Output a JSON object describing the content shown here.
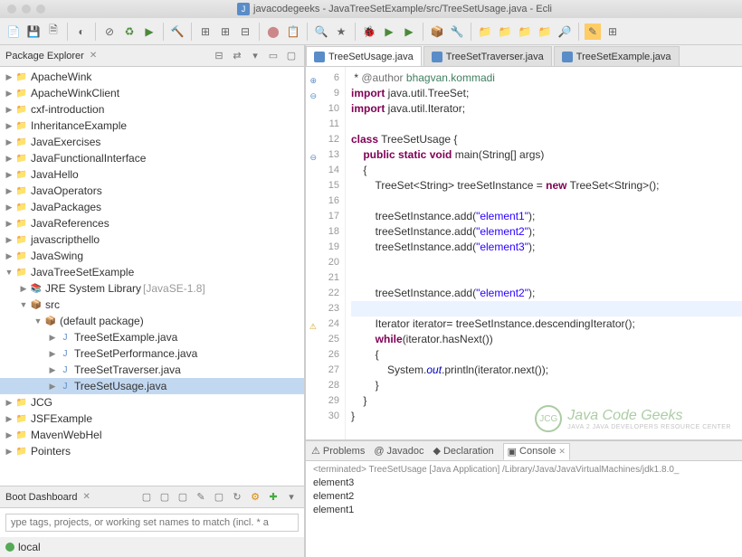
{
  "titlebar": {
    "title": "javacodegeeks - JavaTreeSetExample/src/TreeSetUsage.java - Ecli"
  },
  "packageExplorer": {
    "label": "Package Explorer",
    "items": [
      {
        "name": "ApacheWink",
        "icon": "folder",
        "indent": 0,
        "tw": "▶"
      },
      {
        "name": "ApacheWinkClient",
        "icon": "folder",
        "indent": 0,
        "tw": "▶"
      },
      {
        "name": "cxf-introduction",
        "icon": "folder",
        "indent": 0,
        "tw": "▶"
      },
      {
        "name": "InheritanceExample",
        "icon": "folder",
        "indent": 0,
        "tw": "▶"
      },
      {
        "name": "JavaExercises",
        "icon": "folder",
        "indent": 0,
        "tw": "▶"
      },
      {
        "name": "JavaFunctionalInterface",
        "icon": "folder",
        "indent": 0,
        "tw": "▶"
      },
      {
        "name": "JavaHello",
        "icon": "folder",
        "indent": 0,
        "tw": "▶"
      },
      {
        "name": "JavaOperators",
        "icon": "folder",
        "indent": 0,
        "tw": "▶"
      },
      {
        "name": "JavaPackages",
        "icon": "folder",
        "indent": 0,
        "tw": "▶"
      },
      {
        "name": "JavaReferences",
        "icon": "folder",
        "indent": 0,
        "tw": "▶"
      },
      {
        "name": "javascripthello",
        "icon": "folder",
        "indent": 0,
        "tw": "▶"
      },
      {
        "name": "JavaSwing",
        "icon": "folder",
        "indent": 0,
        "tw": "▶"
      },
      {
        "name": "JavaTreeSetExample",
        "icon": "folder",
        "indent": 0,
        "tw": "▼"
      },
      {
        "name": "JRE System Library",
        "lib": "[JavaSE-1.8]",
        "icon": "lib",
        "indent": 1,
        "tw": "▶"
      },
      {
        "name": "src",
        "icon": "pkg",
        "indent": 1,
        "tw": "▼"
      },
      {
        "name": "(default package)",
        "icon": "pkg",
        "indent": 2,
        "tw": "▼"
      },
      {
        "name": "TreeSetExample.java",
        "icon": "java",
        "indent": 3,
        "tw": "▶"
      },
      {
        "name": "TreeSetPerformance.java",
        "icon": "java",
        "indent": 3,
        "tw": "▶"
      },
      {
        "name": "TreeSetTraverser.java",
        "icon": "java",
        "indent": 3,
        "tw": "▶"
      },
      {
        "name": "TreeSetUsage.java",
        "icon": "java",
        "indent": 3,
        "tw": "▶",
        "selected": true
      },
      {
        "name": "JCG",
        "icon": "folder",
        "indent": 0,
        "tw": "▶"
      },
      {
        "name": "JSFExample",
        "icon": "folder",
        "indent": 0,
        "tw": "▶"
      },
      {
        "name": "MavenWebHel",
        "icon": "folder",
        "indent": 0,
        "tw": "▶"
      },
      {
        "name": "Pointers",
        "icon": "folder",
        "indent": 0,
        "tw": "▶"
      }
    ]
  },
  "bootDashboard": {
    "label": "Boot Dashboard",
    "placeholder": "ype tags, projects, or working set names to match (incl. * a",
    "local": "local"
  },
  "editorTabs": [
    {
      "label": "TreeSetUsage.java",
      "active": true
    },
    {
      "label": "TreeSetTraverser.java",
      "active": false
    },
    {
      "label": "TreeSetExample.java",
      "active": false
    }
  ],
  "code": {
    "startLine": 6,
    "lines": [
      {
        "n": 6,
        "mark": "+",
        "html": " * <span class='ann'>@author</span> <span class='com'>bhagvan.kommadi</span>"
      },
      {
        "n": 9,
        "mark": "-",
        "html": "<span class='kw'>import</span> java.util.TreeSet;"
      },
      {
        "n": 10,
        "html": "<span class='kw'>import</span> java.util.Iterator;"
      },
      {
        "n": 11,
        "html": ""
      },
      {
        "n": 12,
        "html": "<span class='kw'>class</span> TreeSetUsage {"
      },
      {
        "n": 13,
        "mark": "-",
        "html": "    <span class='kw'>public static void</span> main(String[] args)"
      },
      {
        "n": 14,
        "html": "    {"
      },
      {
        "n": 15,
        "html": "        TreeSet&lt;String&gt; treeSetInstance = <span class='kw'>new</span> TreeSet&lt;String&gt;();"
      },
      {
        "n": 16,
        "html": ""
      },
      {
        "n": 17,
        "html": "        treeSetInstance.add(<span class='str'>\"element1\"</span>);"
      },
      {
        "n": 18,
        "html": "        treeSetInstance.add(<span class='str'>\"element2\"</span>);"
      },
      {
        "n": 19,
        "html": "        treeSetInstance.add(<span class='str'>\"element3\"</span>);"
      },
      {
        "n": 20,
        "html": ""
      },
      {
        "n": 21,
        "html": ""
      },
      {
        "n": 22,
        "html": "        treeSetInstance.add(<span class='str'>\"element2\"</span>);"
      },
      {
        "n": 23,
        "hl": true,
        "html": ""
      },
      {
        "n": 24,
        "mark": "!",
        "html": "        Iterator iterator= treeSetInstance.descendingIterator();"
      },
      {
        "n": 25,
        "html": "        <span class='kw'>while</span>(iterator.hasNext())"
      },
      {
        "n": 26,
        "html": "        {"
      },
      {
        "n": 27,
        "html": "            System.<span class='fld'>out</span>.println(iterator.next());"
      },
      {
        "n": 28,
        "html": "        }"
      },
      {
        "n": 29,
        "html": "    }"
      },
      {
        "n": 30,
        "html": "}"
      }
    ]
  },
  "bottomTabs": [
    {
      "label": "Problems",
      "icon": "⚠"
    },
    {
      "label": "Javadoc",
      "icon": "@"
    },
    {
      "label": "Declaration",
      "icon": "◆"
    },
    {
      "label": "Console",
      "icon": "▣",
      "active": true
    }
  ],
  "console": {
    "terminated": "<terminated> TreeSetUsage [Java Application] /Library/Java/JavaVirtualMachines/jdk1.8.0_",
    "output": [
      "element3",
      "element2",
      "element1"
    ]
  },
  "watermark": {
    "brand": "Java Code Geeks",
    "sub": "JAVA 2 JAVA DEVELOPERS RESOURCE CENTER",
    "badge": "JCG"
  }
}
